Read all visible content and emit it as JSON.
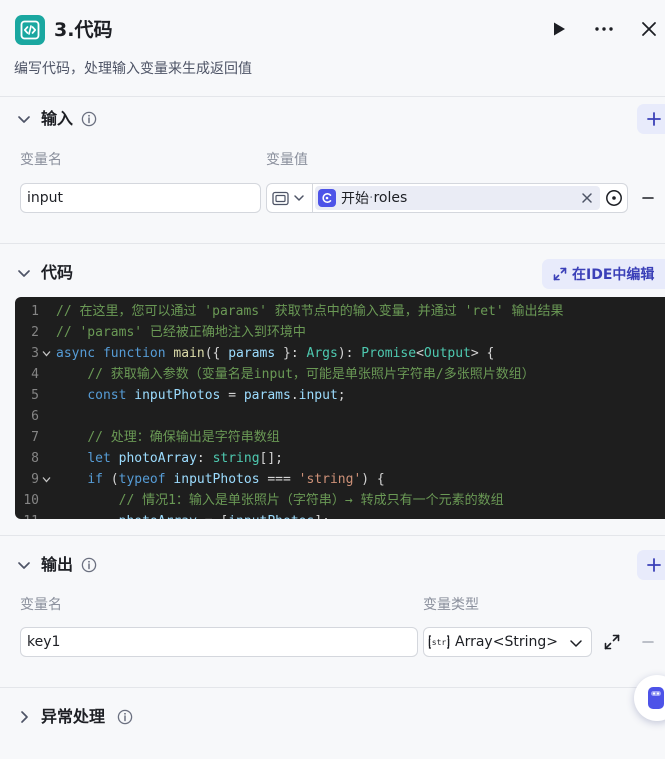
{
  "header": {
    "title": "3.代码",
    "description": "编写代码，处理输入变量来生成返回值",
    "icon": "code-brackets-icon",
    "accent_color": "#1aa7a0"
  },
  "input_section": {
    "title": "输入",
    "col_name_label": "变量名",
    "col_value_label": "变量值",
    "rows": [
      {
        "name": "input",
        "ref_node": "开始",
        "ref_separator": " · ",
        "ref_var": "roles"
      }
    ]
  },
  "code_section": {
    "title": "代码",
    "ide_button_label": "在IDE中编辑",
    "lines": [
      {
        "n": "1",
        "tokens": [
          {
            "c": "comment",
            "t": "// 在这里，您可以通过 'params' 获取节点中的输入变量，并通过 'ret' 输出结果"
          }
        ]
      },
      {
        "n": "2",
        "tokens": [
          {
            "c": "comment",
            "t": "// 'params' 已经被正确地注入到环境中"
          }
        ]
      },
      {
        "n": "3",
        "tokens": [
          {
            "c": "kw",
            "t": "async"
          },
          {
            "c": "pun",
            "t": " "
          },
          {
            "c": "kw",
            "t": "function"
          },
          {
            "c": "pun",
            "t": " "
          },
          {
            "c": "fn",
            "t": "main"
          },
          {
            "c": "pun",
            "t": "({ "
          },
          {
            "c": "var",
            "t": "params"
          },
          {
            "c": "pun",
            "t": " }: "
          },
          {
            "c": "type",
            "t": "Args"
          },
          {
            "c": "pun",
            "t": "): "
          },
          {
            "c": "type",
            "t": "Promise"
          },
          {
            "c": "pun",
            "t": "<"
          },
          {
            "c": "type",
            "t": "Output"
          },
          {
            "c": "pun",
            "t": "> {"
          }
        ]
      },
      {
        "n": "4",
        "tokens": [
          {
            "c": "pun",
            "t": "    "
          },
          {
            "c": "comment",
            "t": "// 获取输入参数（变量名是input，可能是单张照片字符串/多张照片数组）"
          }
        ]
      },
      {
        "n": "5",
        "tokens": [
          {
            "c": "pun",
            "t": "    "
          },
          {
            "c": "kw",
            "t": "const"
          },
          {
            "c": "pun",
            "t": " "
          },
          {
            "c": "var",
            "t": "inputPhotos"
          },
          {
            "c": "pun",
            "t": " = "
          },
          {
            "c": "var",
            "t": "params"
          },
          {
            "c": "pun",
            "t": "."
          },
          {
            "c": "var",
            "t": "input"
          },
          {
            "c": "pun",
            "t": ";"
          }
        ]
      },
      {
        "n": "6",
        "tokens": []
      },
      {
        "n": "7",
        "tokens": [
          {
            "c": "pun",
            "t": "    "
          },
          {
            "c": "comment",
            "t": "// 处理：确保输出是字符串数组"
          }
        ]
      },
      {
        "n": "8",
        "tokens": [
          {
            "c": "pun",
            "t": "    "
          },
          {
            "c": "kw",
            "t": "let"
          },
          {
            "c": "pun",
            "t": " "
          },
          {
            "c": "var",
            "t": "photoArray"
          },
          {
            "c": "pun",
            "t": ": "
          },
          {
            "c": "type",
            "t": "string"
          },
          {
            "c": "pun",
            "t": "[];"
          }
        ]
      },
      {
        "n": "9",
        "tokens": [
          {
            "c": "pun",
            "t": "    "
          },
          {
            "c": "kw",
            "t": "if"
          },
          {
            "c": "pun",
            "t": " ("
          },
          {
            "c": "kw",
            "t": "typeof"
          },
          {
            "c": "pun",
            "t": " "
          },
          {
            "c": "var",
            "t": "inputPhotos"
          },
          {
            "c": "pun",
            "t": " === "
          },
          {
            "c": "str",
            "t": "'string'"
          },
          {
            "c": "pun",
            "t": ") {"
          }
        ]
      },
      {
        "n": "10",
        "tokens": [
          {
            "c": "pun",
            "t": "        "
          },
          {
            "c": "comment",
            "t": "// 情况1：输入是单张照片（字符串）→ 转成只有一个元素的数组"
          }
        ]
      },
      {
        "n": "11",
        "tokens": [
          {
            "c": "pun",
            "t": "        "
          },
          {
            "c": "var",
            "t": "photoArray"
          },
          {
            "c": "pun",
            "t": " = ["
          },
          {
            "c": "var",
            "t": "inputPhotos"
          },
          {
            "c": "pun",
            "t": "];"
          }
        ]
      }
    ]
  },
  "output_section": {
    "title": "输出",
    "col_name_label": "变量名",
    "col_type_label": "变量类型",
    "rows": [
      {
        "name": "key1",
        "type_label": "Array<String>",
        "type_icon_text": "[str]"
      }
    ]
  },
  "exception_section": {
    "title": "异常处理"
  }
}
